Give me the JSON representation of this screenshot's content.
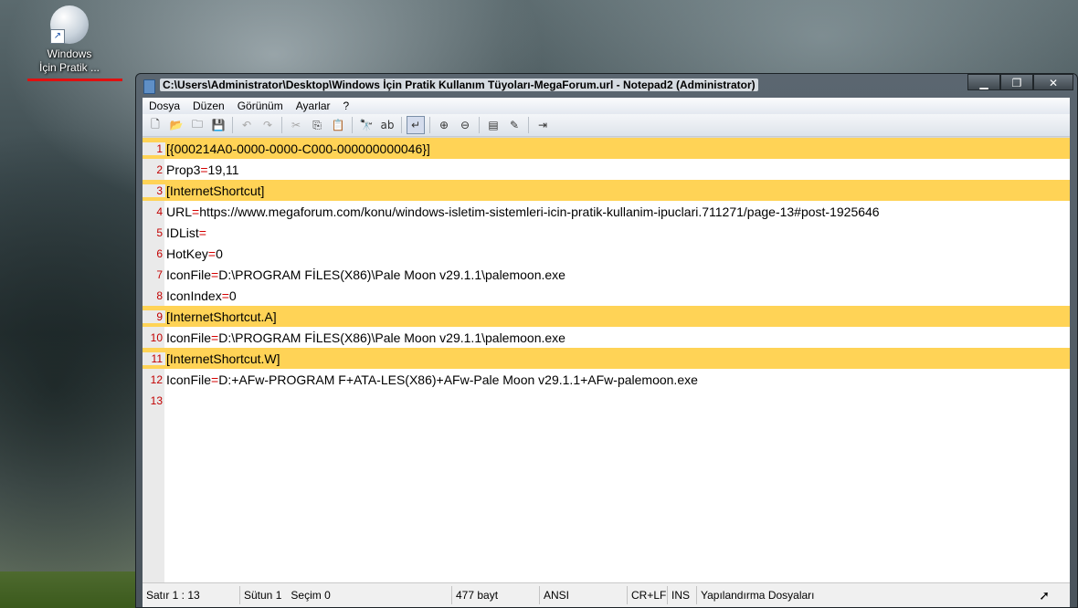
{
  "desktop": {
    "icon_label_line1": "Windows",
    "icon_label_line2": "İçin Pratik ..."
  },
  "window": {
    "title": "C:\\Users\\Administrator\\Desktop\\Windows İçin Pratik Kullanım Tüyoları-MegaForum.url - Notepad2 (Administrator)",
    "buttons": {
      "minimize": "▁",
      "maximize": "❐",
      "close": "✕"
    }
  },
  "menu": [
    "Dosya",
    "Düzen",
    "Görünüm",
    "Ayarlar",
    "?"
  ],
  "toolbar": [
    {
      "icon": "new-icon",
      "glyph": "🗋"
    },
    {
      "icon": "open-icon",
      "glyph": "📂"
    },
    {
      "icon": "browse-icon",
      "glyph": "🗀"
    },
    {
      "icon": "save-icon",
      "glyph": "💾"
    },
    {
      "icon": "undo-icon",
      "glyph": "↶"
    },
    {
      "icon": "redo-icon",
      "glyph": "↷"
    },
    {
      "icon": "cut-icon",
      "glyph": "✂"
    },
    {
      "icon": "copy-icon",
      "glyph": "⎘"
    },
    {
      "icon": "paste-icon",
      "glyph": "📋"
    },
    {
      "icon": "find-icon",
      "glyph": "🔭"
    },
    {
      "icon": "replace-icon",
      "glyph": "ab"
    },
    {
      "icon": "wordwrap-icon",
      "glyph": "↵"
    },
    {
      "icon": "zoom-in-icon",
      "glyph": "⊕"
    },
    {
      "icon": "zoom-out-icon",
      "glyph": "⊖"
    },
    {
      "icon": "scheme-icon",
      "glyph": "▤"
    },
    {
      "icon": "customize-icon",
      "glyph": "✎"
    },
    {
      "icon": "exit-icon",
      "glyph": "⇥"
    }
  ],
  "lines": [
    {
      "n": "1",
      "pre": "[{000214A0-0000-0000-C000-000000000046}]",
      "eq": "",
      "post": "",
      "hl": true
    },
    {
      "n": "2",
      "pre": "Prop3",
      "eq": "=",
      "post": "19,11",
      "hl": false
    },
    {
      "n": "3",
      "pre": "[InternetShortcut]",
      "eq": "",
      "post": "",
      "hl": true
    },
    {
      "n": "4",
      "pre": "URL",
      "eq": "=",
      "post": "https://www.megaforum.com/konu/windows-isletim-sistemleri-icin-pratik-kullanim-ipuclari.711271/page-13#post-1925646",
      "hl": false
    },
    {
      "n": "5",
      "pre": "IDList",
      "eq": "=",
      "post": "",
      "hl": false
    },
    {
      "n": "6",
      "pre": "HotKey",
      "eq": "=",
      "post": "0",
      "hl": false
    },
    {
      "n": "7",
      "pre": "IconFile",
      "eq": "=",
      "post": "D:\\PROGRAM FİLES(X86)\\Pale Moon v29.1.1\\palemoon.exe",
      "hl": false
    },
    {
      "n": "8",
      "pre": "IconIndex",
      "eq": "=",
      "post": "0",
      "hl": false
    },
    {
      "n": "9",
      "pre": "[InternetShortcut.A]",
      "eq": "",
      "post": "",
      "hl": true
    },
    {
      "n": "10",
      "pre": "IconFile",
      "eq": "=",
      "post": "D:\\PROGRAM FİLES(X86)\\Pale Moon v29.1.1\\palemoon.exe",
      "hl": false
    },
    {
      "n": "11",
      "pre": "[InternetShortcut.W]",
      "eq": "",
      "post": "",
      "hl": true
    },
    {
      "n": "12",
      "pre": "IconFile",
      "eq": "=",
      "post": "D:+AFw-PROGRAM F+ATA-LES(X86)+AFw-Pale Moon v29.1.1+AFw-palemoon.exe",
      "hl": false
    },
    {
      "n": "13",
      "pre": "",
      "eq": "",
      "post": "",
      "hl": false
    }
  ],
  "status": {
    "position": "Satır 1 : 13",
    "column": "Sütun 1",
    "selection": "Seçim 0",
    "size": "477 bayt",
    "encoding": "ANSI",
    "eol": "CR+LF",
    "mode": "INS",
    "scheme": "Yapılandırma Dosyaları"
  },
  "colors": {
    "highlight": "#ffd356",
    "line_numbers": "#c20000",
    "equals": "#d40000",
    "annotation": "#e01010"
  }
}
